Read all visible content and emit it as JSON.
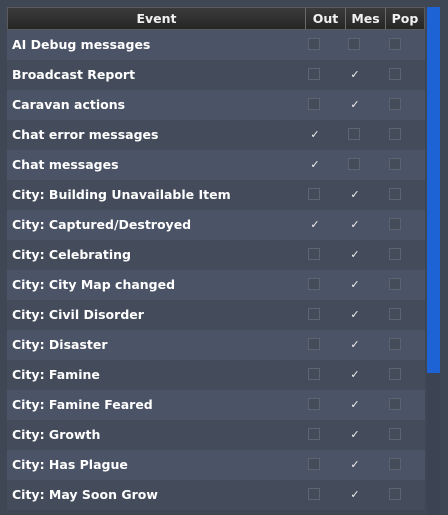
{
  "columns": {
    "event": "Event",
    "out": "Out",
    "mes": "Mes",
    "pop": "Pop"
  },
  "rows": [
    {
      "label": "AI Debug messages",
      "out": false,
      "mes": false,
      "pop": false
    },
    {
      "label": "Broadcast Report",
      "out": false,
      "mes": true,
      "pop": false
    },
    {
      "label": "Caravan actions",
      "out": false,
      "mes": true,
      "pop": false
    },
    {
      "label": "Chat error messages",
      "out": true,
      "mes": false,
      "pop": false
    },
    {
      "label": "Chat messages",
      "out": true,
      "mes": false,
      "pop": false
    },
    {
      "label": "City: Building Unavailable Item",
      "out": false,
      "mes": true,
      "pop": false
    },
    {
      "label": "City: Captured/Destroyed",
      "out": true,
      "mes": true,
      "pop": false
    },
    {
      "label": "City: Celebrating",
      "out": false,
      "mes": true,
      "pop": false
    },
    {
      "label": "City: City Map changed",
      "out": false,
      "mes": true,
      "pop": false
    },
    {
      "label": "City: Civil Disorder",
      "out": false,
      "mes": true,
      "pop": false
    },
    {
      "label": "City: Disaster",
      "out": false,
      "mes": true,
      "pop": false
    },
    {
      "label": "City: Famine",
      "out": false,
      "mes": true,
      "pop": false
    },
    {
      "label": "City: Famine Feared",
      "out": false,
      "mes": true,
      "pop": false
    },
    {
      "label": "City: Growth",
      "out": false,
      "mes": true,
      "pop": false
    },
    {
      "label": "City: Has Plague",
      "out": false,
      "mes": true,
      "pop": false
    },
    {
      "label": "City: May Soon Grow",
      "out": false,
      "mes": true,
      "pop": false
    }
  ],
  "scrollbar": {
    "thumb_fraction": 0.72,
    "thumb_color": "#1e63d6"
  },
  "icons": {
    "check": "checkmark-icon"
  }
}
